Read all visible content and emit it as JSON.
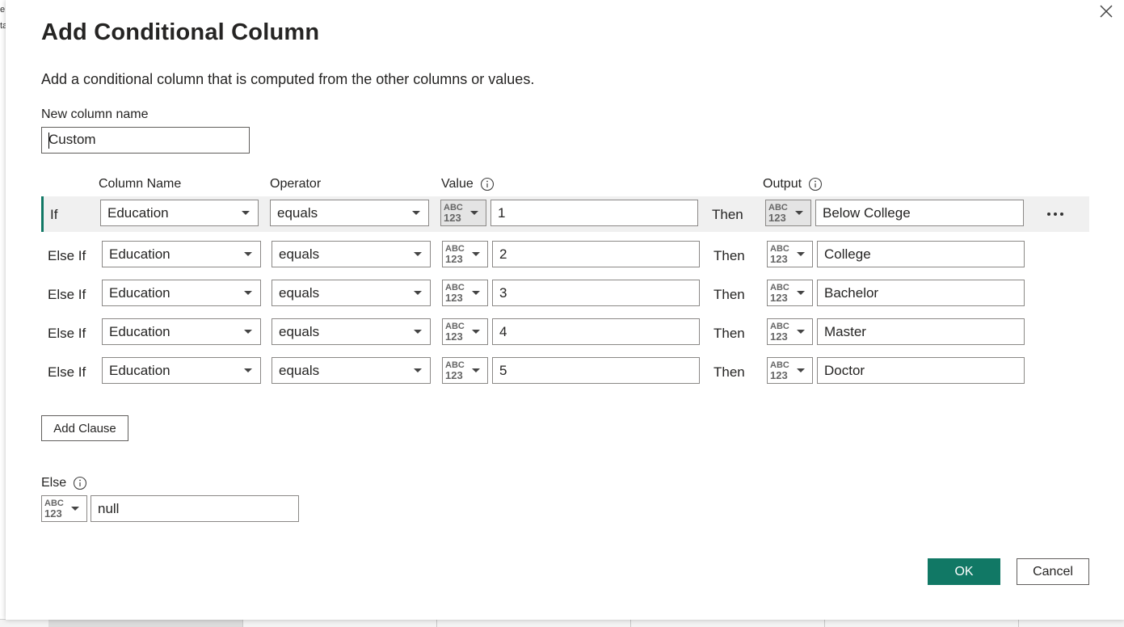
{
  "background": {
    "left_fragments": [
      "e",
      "ta"
    ]
  },
  "dialog": {
    "title": "Add Conditional Column",
    "description": "Add a conditional column that is computed from the other columns or values.",
    "new_column_label": "New column name",
    "new_column_value": "Custom"
  },
  "headers": {
    "column_name": "Column Name",
    "operator": "Operator",
    "value": "Value",
    "output": "Output"
  },
  "type_icon": {
    "top": "ABC",
    "bottom": "123"
  },
  "rows": [
    {
      "keyword": "If",
      "column": "Education",
      "operator": "equals",
      "value": "1",
      "then": "Then",
      "output": "Below College"
    },
    {
      "keyword": "Else If",
      "column": "Education",
      "operator": "equals",
      "value": "2",
      "then": "Then",
      "output": "College"
    },
    {
      "keyword": "Else If",
      "column": "Education",
      "operator": "equals",
      "value": "3",
      "then": "Then",
      "output": "Bachelor"
    },
    {
      "keyword": "Else If",
      "column": "Education",
      "operator": "equals",
      "value": "4",
      "then": "Then",
      "output": "Master"
    },
    {
      "keyword": "Else If",
      "column": "Education",
      "operator": "equals",
      "value": "5",
      "then": "Then",
      "output": "Doctor"
    }
  ],
  "add_clause_label": "Add Clause",
  "else": {
    "label": "Else",
    "value": "null"
  },
  "buttons": {
    "ok": "OK",
    "cancel": "Cancel"
  },
  "colors": {
    "accent": "#117865",
    "border": "#8a8886",
    "row_highlight": "#f0f0f0"
  }
}
